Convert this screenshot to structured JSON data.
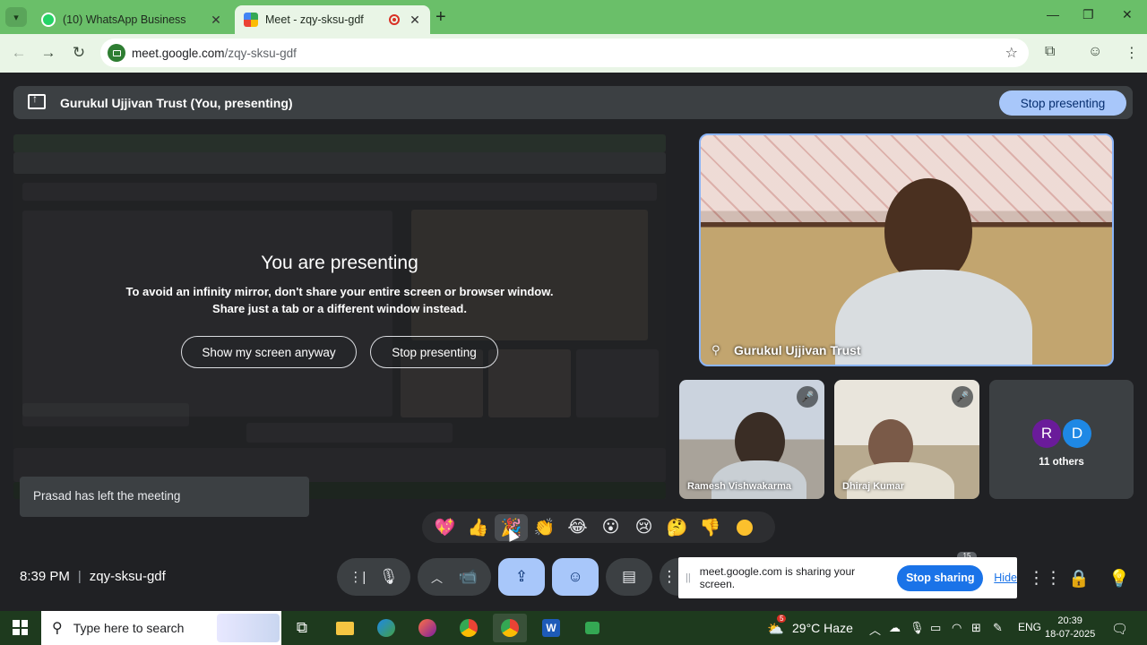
{
  "browser": {
    "tabs": [
      {
        "title": "(10) WhatsApp Business",
        "active": false
      },
      {
        "title": "Meet - zqy-sksu-gdf",
        "active": true,
        "recording": true
      }
    ],
    "url_host": "meet.google.com",
    "url_path": "/zqy-sksu-gdf"
  },
  "present_bar": {
    "title": "Gurukul Ujjivan Trust (You, presenting)",
    "stop_button": "Stop presenting"
  },
  "share_preview": {
    "heading": "You are presenting",
    "message_line1": "To avoid an infinity mirror, don't share your entire screen or browser window.",
    "message_line2": "Share just a tab or a different window instead.",
    "show_anyway": "Show my screen anyway",
    "stop_presenting": "Stop presenting"
  },
  "toast": {
    "text": "Prasad has left the meeting"
  },
  "participants": {
    "main": {
      "name": "Gurukul Ujjivan Trust"
    },
    "tiles": [
      {
        "name": "Ramesh Vishwakarma",
        "muted": true
      },
      {
        "name": "Dhiraj Kumar",
        "muted": true
      }
    ],
    "others": {
      "avatars": [
        "R",
        "D"
      ],
      "label": "11 others",
      "colors": [
        "#7b1fa2",
        "#1e88e5"
      ]
    }
  },
  "reactions": [
    "💖",
    "👍",
    "🎉",
    "👏",
    "😂",
    "😮",
    "😢",
    "🤔",
    "👎"
  ],
  "selected_reaction_index": 2,
  "meeting": {
    "time": "8:39 PM",
    "code": "zqy-sksu-gdf"
  },
  "controls": {
    "participants_badge": "15"
  },
  "sharing_bar": {
    "text": "meet.google.com is sharing your screen.",
    "stop": "Stop sharing",
    "hide": "Hide"
  },
  "taskbar": {
    "search_placeholder": "Type here to search",
    "weather": "29°C  Haze",
    "weather_badge": "5",
    "language": "ENG",
    "time": "20:39",
    "date": "18-07-2025"
  },
  "colors": {
    "tabstrip": "#6abf69",
    "accent_blue": "#a8c7fa",
    "stop_sharing_blue": "#1a73e8",
    "meet_bg": "#202124"
  }
}
